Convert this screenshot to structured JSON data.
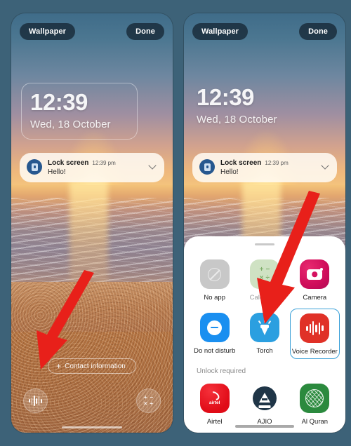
{
  "background_color": "#3d6278",
  "accent_color": "#3aa0d8",
  "arrow_color": "#e8201a",
  "phones": {
    "left": {
      "name": "lock-screen-editor",
      "topbar": {
        "wallpaper_label": "Wallpaper",
        "done_label": "Done"
      },
      "clock": {
        "time": "12:39",
        "date": "Wed, 18 October",
        "framed": true
      },
      "notification": {
        "icon": "lock-icon",
        "title": "Lock screen",
        "time": "12:39 pm",
        "text": "Hello!",
        "expand_icon": "chevron-down-icon"
      },
      "contact_info_label": "Contact information",
      "shortcuts": [
        {
          "name": "voice-recorder-shortcut",
          "icon": "waveform-icon"
        },
        {
          "name": "calculator-shortcut",
          "icon": "calculator-icon"
        }
      ]
    },
    "right": {
      "name": "lock-screen-shortcut-picker",
      "topbar": {
        "wallpaper_label": "Wallpaper",
        "done_label": "Done"
      },
      "clock": {
        "time": "12:39",
        "date": "Wed, 18 October",
        "framed": false
      },
      "notification": {
        "icon": "lock-icon",
        "title": "Lock screen",
        "time": "12:39 pm",
        "text": "Hello!",
        "expand_icon": "chevron-down-icon"
      },
      "sheet": {
        "grabber": "drag-handle",
        "apps": [
          {
            "label": "No app",
            "icon": "no-app-icon",
            "color": "#c8c8c8",
            "selected": false,
            "dim": false
          },
          {
            "label": "Calculator",
            "icon": "calculator-icon",
            "color": "#cfe2c3",
            "selected": false,
            "dim": true
          },
          {
            "label": "Camera",
            "icon": "camera-icon",
            "color": "#d51160",
            "selected": false,
            "dim": false
          },
          {
            "label": "Do not disturb",
            "icon": "do-not-disturb-icon",
            "color": "#1a8ff0",
            "selected": false,
            "dim": false
          },
          {
            "label": "Torch",
            "icon": "torch-icon",
            "color": "#2b9fe0",
            "selected": false,
            "dim": false
          },
          {
            "label": "Voice Recorder",
            "icon": "waveform-icon",
            "color": "#e03127",
            "selected": true,
            "dim": false
          }
        ],
        "section_title": "Unlock required",
        "locked_apps": [
          {
            "label": "Airtel",
            "icon": "airtel-icon",
            "color": "#e00b17"
          },
          {
            "label": "AJIO",
            "icon": "ajio-icon",
            "color": "#1f3547"
          },
          {
            "label": "Al Quran",
            "icon": "al-quran-icon",
            "color": "#2b8a3e"
          }
        ]
      }
    }
  },
  "annotations": [
    {
      "name": "arrow-to-voice-recorder-shortcut",
      "direction": "down-left"
    },
    {
      "name": "arrow-to-torch-app",
      "direction": "down-left"
    }
  ]
}
